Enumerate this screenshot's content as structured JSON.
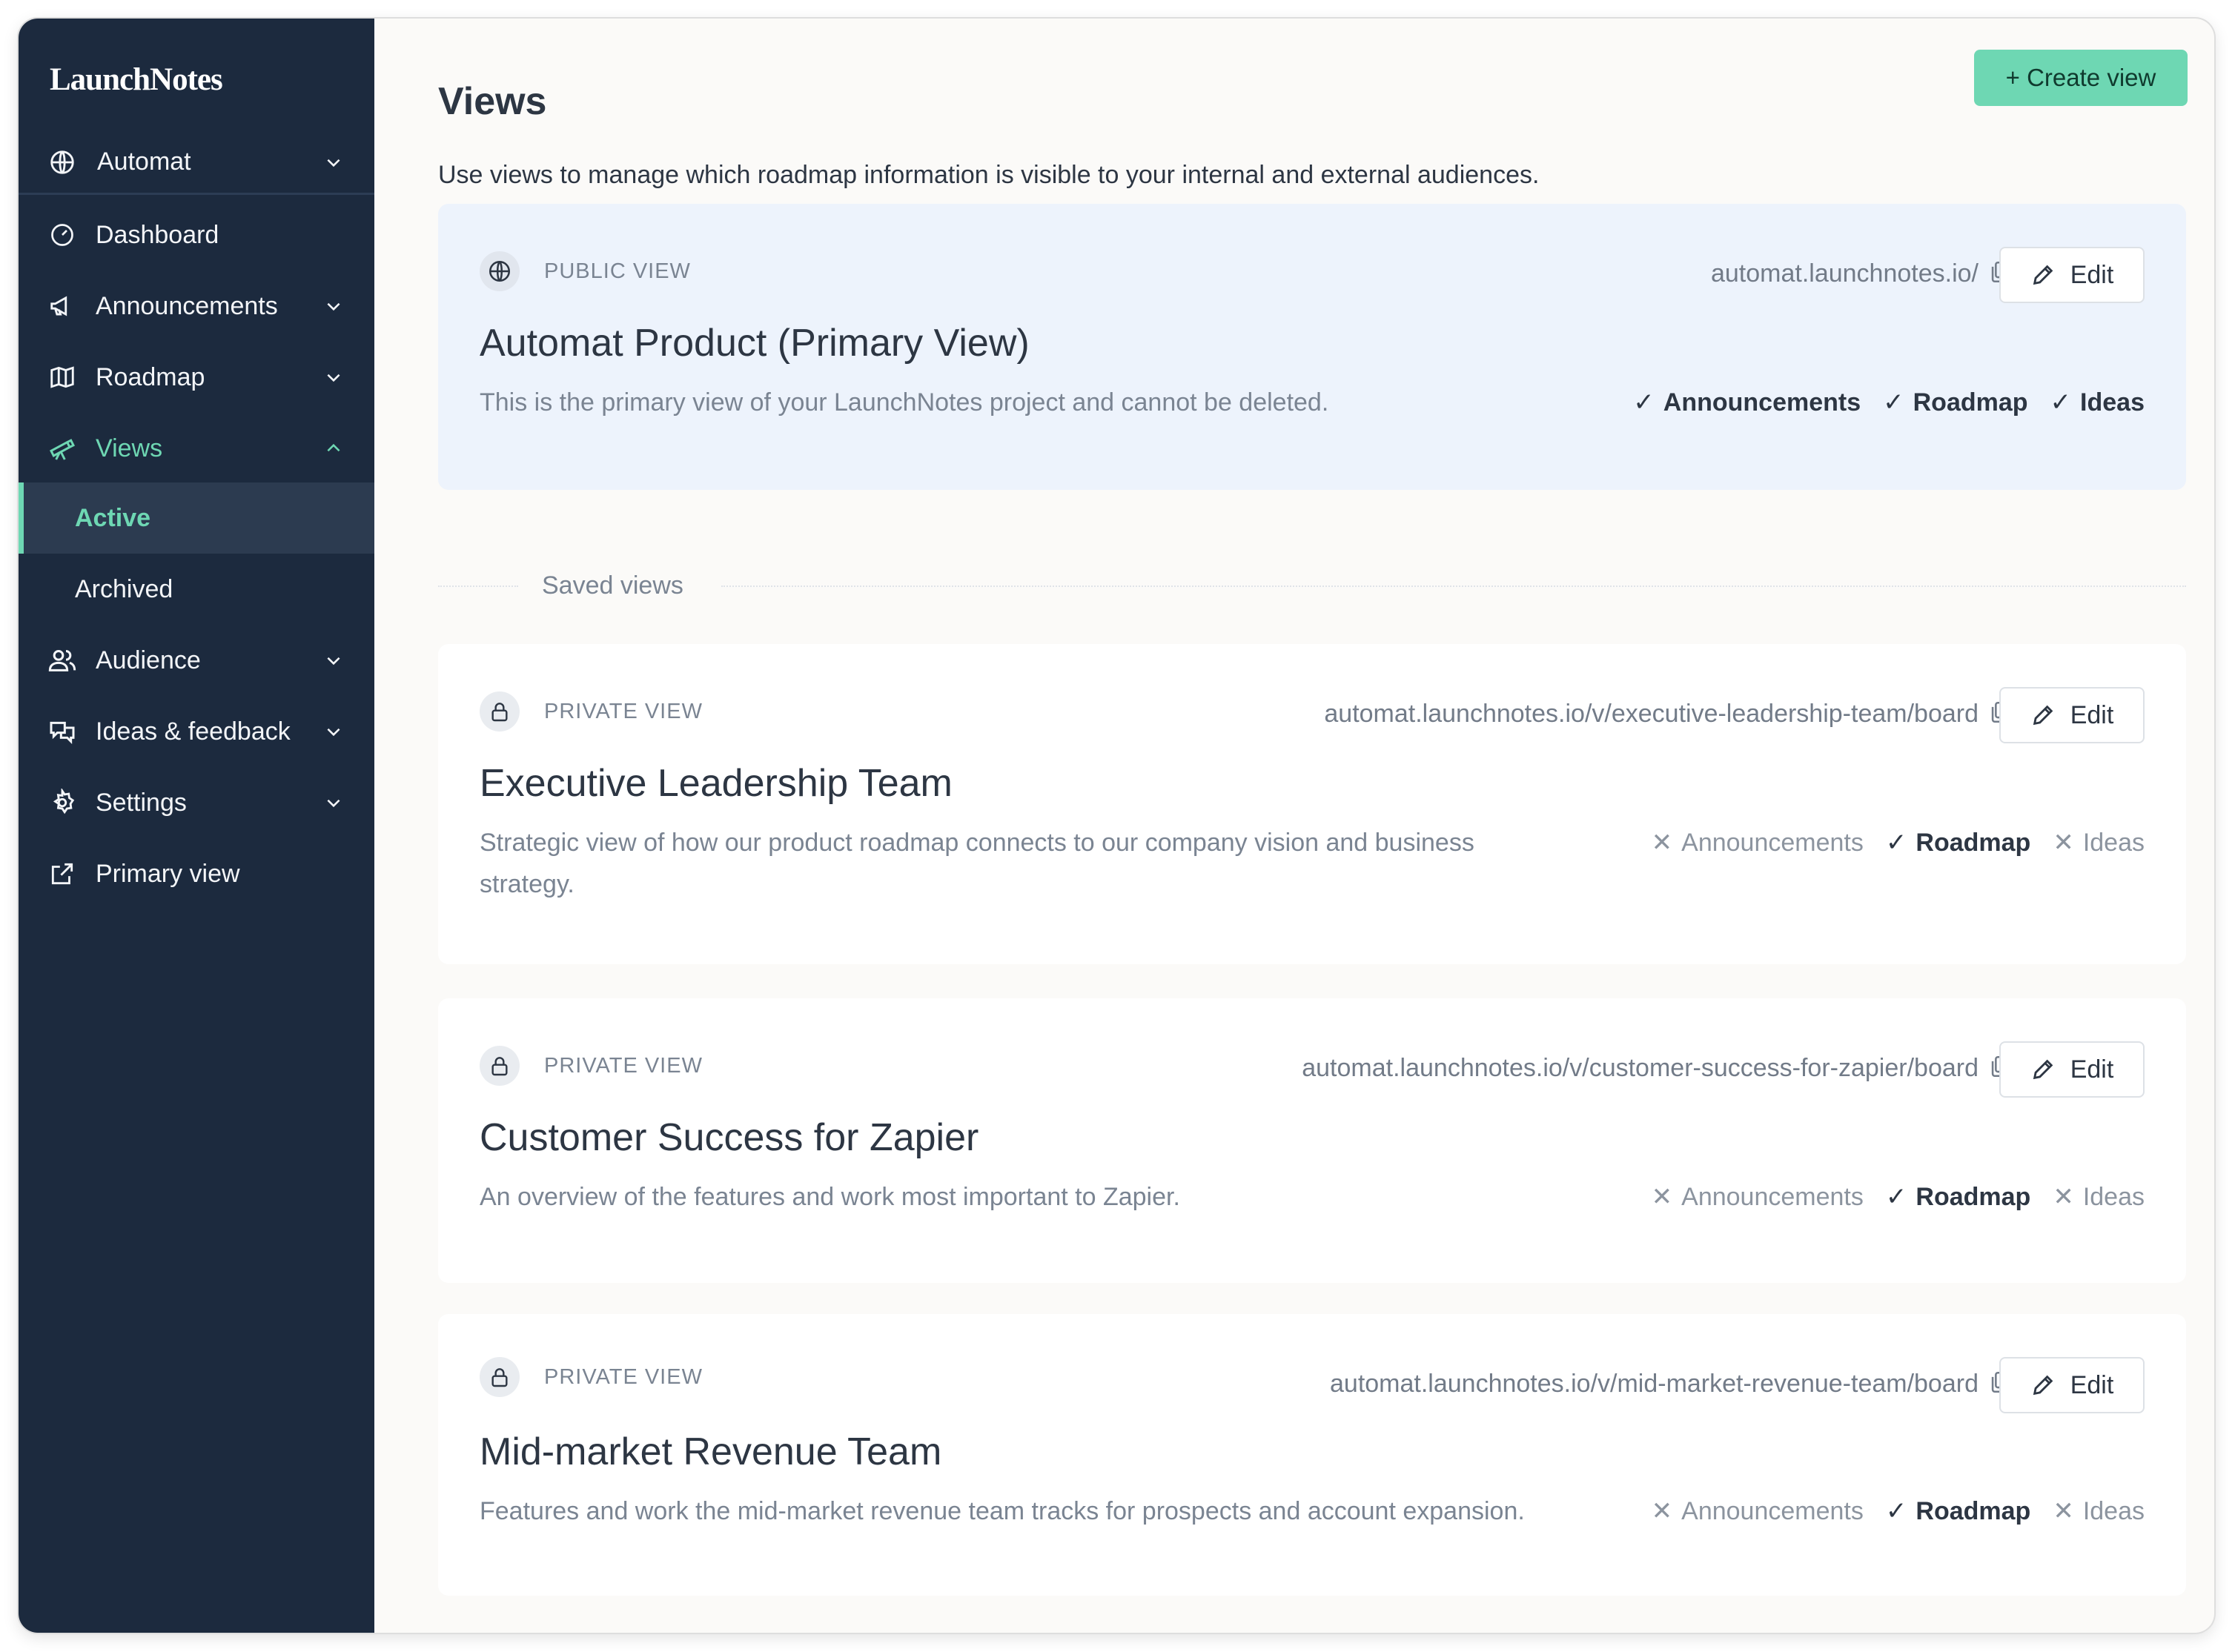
{
  "sidebar": {
    "brand": "LaunchNotes",
    "workspace": "Automat",
    "items": [
      {
        "label": "Dashboard",
        "icon": "gauge-icon"
      },
      {
        "label": "Announcements",
        "icon": "megaphone-icon"
      },
      {
        "label": "Roadmap",
        "icon": "map-icon"
      },
      {
        "label": "Views",
        "icon": "telescope-icon"
      },
      {
        "label": "Audience",
        "icon": "users-icon"
      },
      {
        "label": "Ideas & feedback",
        "icon": "chat-bubbles-icon"
      },
      {
        "label": "Settings",
        "icon": "gear-icon"
      },
      {
        "label": "Primary view",
        "icon": "external-link-icon"
      }
    ],
    "views_sub": [
      {
        "label": "Active",
        "active": true
      },
      {
        "label": "Archived",
        "active": false
      }
    ],
    "accent": "#6ed7b3",
    "background": "#1c2a3e"
  },
  "header": {
    "title": "Views",
    "create_button": "+ Create view",
    "description": "Use views to manage which roadmap information is visible to your internal and external audiences."
  },
  "primary_view": {
    "type": "PUBLIC VIEW",
    "url": "automat.launchnotes.io/",
    "edit_label": "Edit",
    "title": "Automat Product (Primary View)",
    "description": "This is the primary view of your LaunchNotes project and cannot be deleted.",
    "features": [
      {
        "label": "Announcements",
        "enabled": true
      },
      {
        "label": "Roadmap",
        "enabled": true
      },
      {
        "label": "Ideas",
        "enabled": true
      }
    ]
  },
  "saved_views_label": "Saved views",
  "saved_views": [
    {
      "type": "PRIVATE VIEW",
      "url": "automat.launchnotes.io/v/executive-leadership-team/board",
      "edit_label": "Edit",
      "title": "Executive Leadership Team",
      "description_line1": "Strategic view of how our product roadmap connects to our company vision and business",
      "description_line2": "strategy.",
      "features": [
        {
          "label": "Announcements",
          "enabled": false
        },
        {
          "label": "Roadmap",
          "enabled": true
        },
        {
          "label": "Ideas",
          "enabled": false
        }
      ]
    },
    {
      "type": "PRIVATE VIEW",
      "url": "automat.launchnotes.io/v/customer-success-for-zapier/board",
      "edit_label": "Edit",
      "title": "Customer Success for Zapier",
      "description_line1": "An overview of the features and work most important to Zapier.",
      "features": [
        {
          "label": "Announcements",
          "enabled": false
        },
        {
          "label": "Roadmap",
          "enabled": true
        },
        {
          "label": "Ideas",
          "enabled": false
        }
      ]
    },
    {
      "type": "PRIVATE VIEW",
      "url": "automat.launchnotes.io/v/mid-market-revenue-team/board",
      "edit_label": "Edit",
      "title": "Mid-market Revenue Team",
      "description_line1": "Features and work the mid-market revenue team tracks for prospects and account expansion.",
      "features": [
        {
          "label": "Announcements",
          "enabled": false
        },
        {
          "label": "Roadmap",
          "enabled": true
        },
        {
          "label": "Ideas",
          "enabled": false
        }
      ]
    }
  ]
}
